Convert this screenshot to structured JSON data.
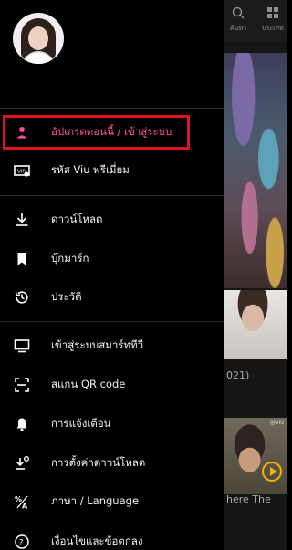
{
  "colors": {
    "accent_pink": "#ff4f9b",
    "highlight_red": "#e0141e",
    "drawer_bg": "#000000",
    "text": "#f2f2f2"
  },
  "drawer": {
    "menu": [
      {
        "id": "login",
        "label": "อัปเกรดตอนนี้ / เข้าสู่ระบบ",
        "icon": "person-icon"
      },
      {
        "id": "viu-code",
        "label": "รหัส Viu พรีเมี่ยม",
        "icon": "ticket-icon"
      },
      {
        "id": "download",
        "label": "ดาวน์โหลด",
        "icon": "download-icon"
      },
      {
        "id": "bookmark",
        "label": "บุ๊กมาร์ก",
        "icon": "bookmark-icon"
      },
      {
        "id": "history",
        "label": "ประวัติ",
        "icon": "history-icon"
      },
      {
        "id": "smart-tv",
        "label": "เข้าสู่ระบบสมาร์ททีวี",
        "icon": "tv-icon"
      },
      {
        "id": "qr",
        "label": "สแกน QR code",
        "icon": "qr-scan-icon"
      },
      {
        "id": "notifications",
        "label": "การแจ้งเตือน",
        "icon": "bell-icon"
      },
      {
        "id": "download-settings",
        "label": "การตั้งค่าดาวน์โหลด",
        "icon": "download-settings-icon"
      },
      {
        "id": "language",
        "label": "ภาษา / Language",
        "icon": "translate-icon"
      },
      {
        "id": "terms",
        "label": "เงื่อนไขและข้อตกลง",
        "icon": "help-circle-icon"
      }
    ]
  },
  "background": {
    "search_label": "ค้นหา",
    "category_label": "ประเภท",
    "poster_tag": "@viu",
    "text_year": "021)",
    "text_title": "here The"
  }
}
